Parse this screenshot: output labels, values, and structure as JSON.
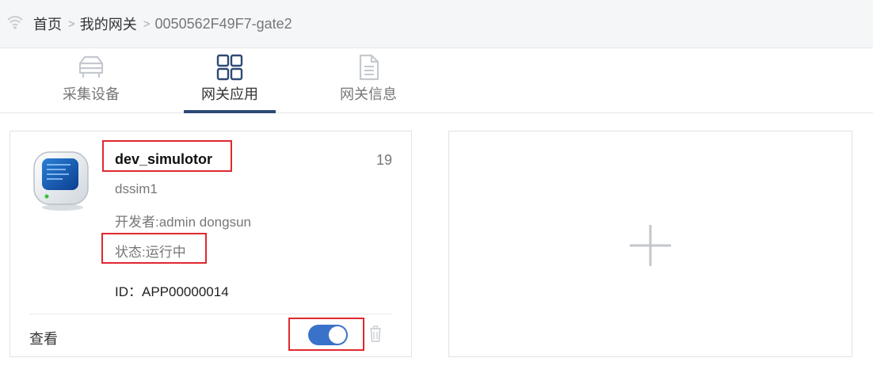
{
  "breadcrumb": {
    "home": "首页",
    "separator": ">",
    "level2": "我的网关",
    "current": "0050562F49F7-gate2"
  },
  "tabs": [
    {
      "label": "采集设备",
      "icon": "server-icon"
    },
    {
      "label": "网关应用",
      "icon": "grid-icon"
    },
    {
      "label": "网关信息",
      "icon": "document-icon"
    }
  ],
  "app_card": {
    "name": "dev_simulotor",
    "count": "19",
    "subname": "dssim1",
    "developer": "开发者:admin dongsun",
    "status": "状态:运行中",
    "id": "ID：APP00000014",
    "view_label": "查看",
    "toggle_on": true
  },
  "colors": {
    "accent": "#2f4a75",
    "toggle": "#3b72c9",
    "highlight": "#e0282f"
  }
}
